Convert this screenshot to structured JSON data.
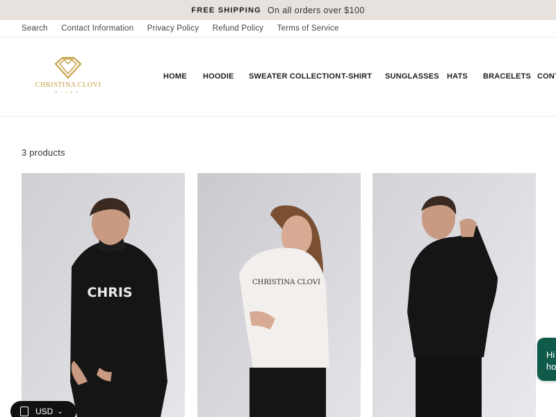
{
  "announcement": {
    "strong": "FREE SHIPPING",
    "text": "On all orders over $100"
  },
  "toplinks": [
    "Search",
    "Contact Information",
    "Privacy Policy",
    "Refund Policy",
    "Terms of Service"
  ],
  "logo": {
    "brand": "CHRISTINA CLOVI",
    "sub": "MILAN"
  },
  "nav": [
    "HOME",
    "HOODIE",
    "SWEATER COLLECTION",
    "T-SHIRT",
    "SUNGLASSES",
    "HATS",
    "BRACELETS",
    "CONT"
  ],
  "collection": {
    "count": "3 products",
    "products": [
      {
        "print": "CHRIS",
        "color": "#151515"
      },
      {
        "print": "CHRISTINA CLOVI",
        "color": "#f2efed"
      },
      {
        "print": "",
        "color": "#151515"
      }
    ]
  },
  "currency": {
    "code": "USD",
    "caret": "⌄"
  },
  "chat": {
    "line1": "Hi",
    "line2": "ho"
  },
  "colors": {
    "announcement_bg": "#e8e2df",
    "logo_gold": "#c7a24a",
    "chat_bg": "#0f5a49"
  }
}
